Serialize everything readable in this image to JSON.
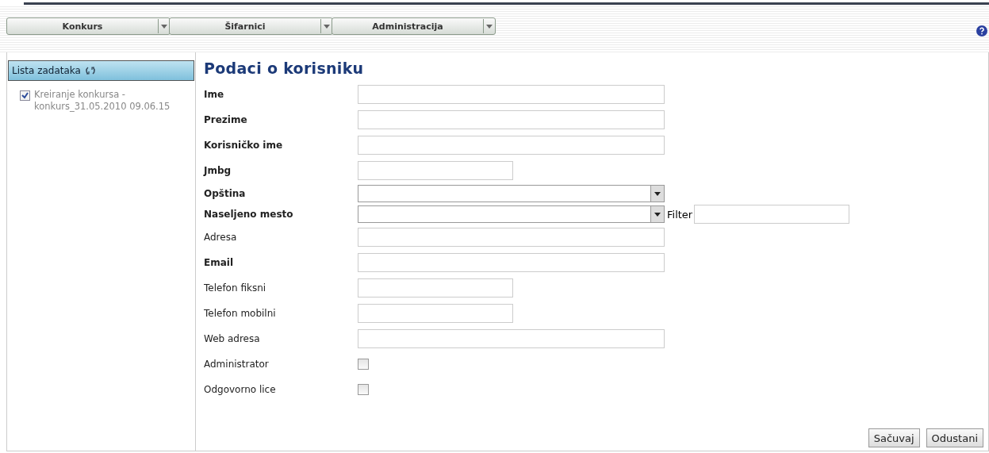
{
  "menu": [
    {
      "label": "Konkurs"
    },
    {
      "label": "Šifarnici"
    },
    {
      "label": "Administracija"
    }
  ],
  "sidebar": {
    "title": "Lista zadataka",
    "tasks": [
      {
        "label": "Kreiranje konkursa - konkurs_31.05.2010 09.06.15",
        "checked": true
      }
    ]
  },
  "form": {
    "title": "Podaci o korisniku",
    "fields": [
      {
        "label": "Ime",
        "bold": true,
        "kind": "text",
        "wide": true
      },
      {
        "label": "Prezime",
        "bold": true,
        "kind": "text",
        "wide": true
      },
      {
        "label": "Korisničko ime",
        "bold": true,
        "kind": "text",
        "wide": true
      },
      {
        "label": "Jmbg",
        "bold": true,
        "kind": "text",
        "wide": false
      },
      {
        "label": "Opština",
        "bold": true,
        "kind": "select"
      },
      {
        "label": "Naseljeno mesto",
        "bold": true,
        "kind": "select",
        "filter_label": "Filter"
      },
      {
        "label": "Adresa",
        "bold": false,
        "kind": "text",
        "wide": true
      },
      {
        "label": "Email",
        "bold": true,
        "kind": "text",
        "wide": true
      },
      {
        "label": "Telefon fiksni",
        "bold": false,
        "kind": "text",
        "wide": false
      },
      {
        "label": "Telefon mobilni",
        "bold": false,
        "kind": "text",
        "wide": false
      },
      {
        "label": "Web adresa",
        "bold": false,
        "kind": "text",
        "wide": true
      },
      {
        "label": "Administrator",
        "bold": false,
        "kind": "checkbox",
        "checked": false
      },
      {
        "label": "Odgovorno lice",
        "bold": false,
        "kind": "checkbox",
        "checked": false
      }
    ],
    "buttons": [
      "Sačuvaj",
      "Odustani"
    ]
  }
}
